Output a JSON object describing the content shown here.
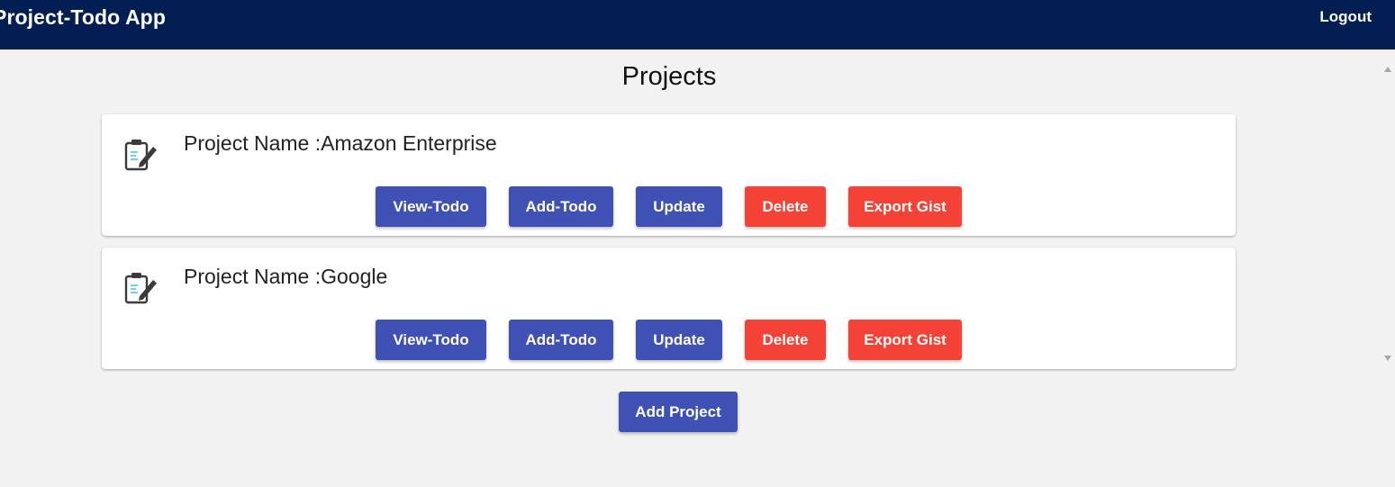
{
  "header": {
    "app_title": "Project-Todo App",
    "logout_label": "Logout",
    "background_color": "#031e53"
  },
  "main": {
    "page_title": "Projects",
    "projects": [
      {
        "name_label": "Project Name :Amazon Enterprise",
        "icon": "clipboard-edit-icon",
        "buttons": {
          "view_todo": "View-Todo",
          "add_todo": "Add-Todo",
          "update": "Update",
          "delete": "Delete",
          "export_gist": "Export Gist"
        }
      },
      {
        "name_label": "Project Name :Google",
        "icon": "clipboard-edit-icon",
        "buttons": {
          "view_todo": "View-Todo",
          "add_todo": "Add-Todo",
          "update": "Update",
          "delete": "Delete",
          "export_gist": "Export Gist"
        }
      }
    ],
    "add_project_label": "Add Project"
  },
  "colors": {
    "primary": "#3f51b5",
    "danger": "#f44336",
    "page_background": "#f2f2f2"
  }
}
